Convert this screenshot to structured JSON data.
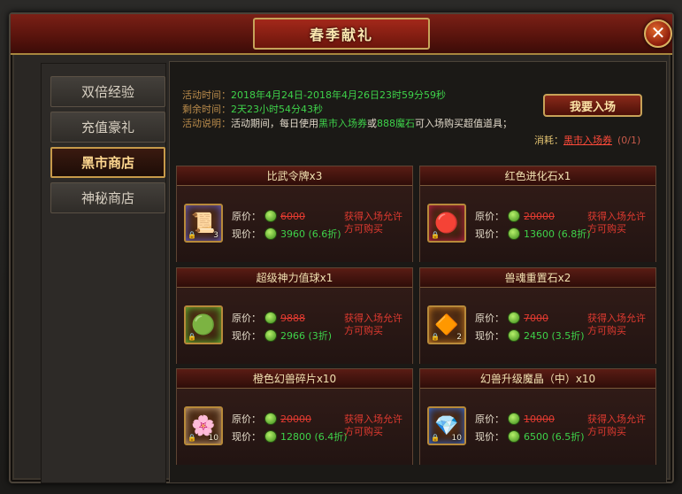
{
  "window": {
    "title": "春季献礼",
    "close_glyph": "✕"
  },
  "sidebar": {
    "items": [
      {
        "label": "双倍经验",
        "active": false
      },
      {
        "label": "充值豪礼",
        "active": false
      },
      {
        "label": "黑市商店",
        "active": true
      },
      {
        "label": "神秘商店",
        "active": false
      }
    ]
  },
  "info": {
    "time_label": "活动时间：",
    "time_value": "2018年4月24日-2018年4月26日23时59分59秒",
    "remain_label": "剩余时间：",
    "remain_value": "2天23小时54分43秒",
    "desc_label": "活动说明：",
    "desc_a": "活动期间，每日使用",
    "desc_ticket": "黑市入场券",
    "desc_b": "或",
    "desc_stone": "888魔石",
    "desc_c": "可入场购买超值道具；"
  },
  "enter_button": "我要入场",
  "consume": {
    "label": "消耗：",
    "item": "黑市入场券",
    "count": "(0/1)"
  },
  "price_labels": {
    "original": "原价：",
    "current": "现价："
  },
  "condition_text": "获得入场允许方可购买",
  "items": [
    {
      "name": "比武令牌x3",
      "original": "6000",
      "current": "3960 (6.6折)",
      "qty": "3",
      "icon": "scroll-icon",
      "glyph": "📜",
      "accent": "#7a6ad0"
    },
    {
      "name": "红色进化石x1",
      "original": "20000",
      "current": "13600 (6.8折)",
      "qty": "",
      "icon": "red-stone-icon",
      "glyph": "🔴",
      "accent": "#d02a4a"
    },
    {
      "name": "超级神力值球x1",
      "original": "9888",
      "current": "2966 (3折)",
      "qty": "",
      "icon": "orb-icon",
      "glyph": "🟢",
      "accent": "#7ad03a"
    },
    {
      "name": "兽魂重置石x2",
      "original": "7000",
      "current": "2450 (3.5折)",
      "qty": "2",
      "icon": "gem-icon",
      "glyph": "🔶",
      "accent": "#e08a2a"
    },
    {
      "name": "橙色幻兽碎片x10",
      "original": "20000",
      "current": "12800 (6.4折)",
      "qty": "10",
      "icon": "fragment-icon",
      "glyph": "🌸",
      "accent": "#e0b080"
    },
    {
      "name": "幻兽升级魔晶（中）x10",
      "original": "10000",
      "current": "6500 (6.5折)",
      "qty": "10",
      "icon": "crystal-icon",
      "glyph": "💎",
      "accent": "#4a7ae0"
    }
  ]
}
